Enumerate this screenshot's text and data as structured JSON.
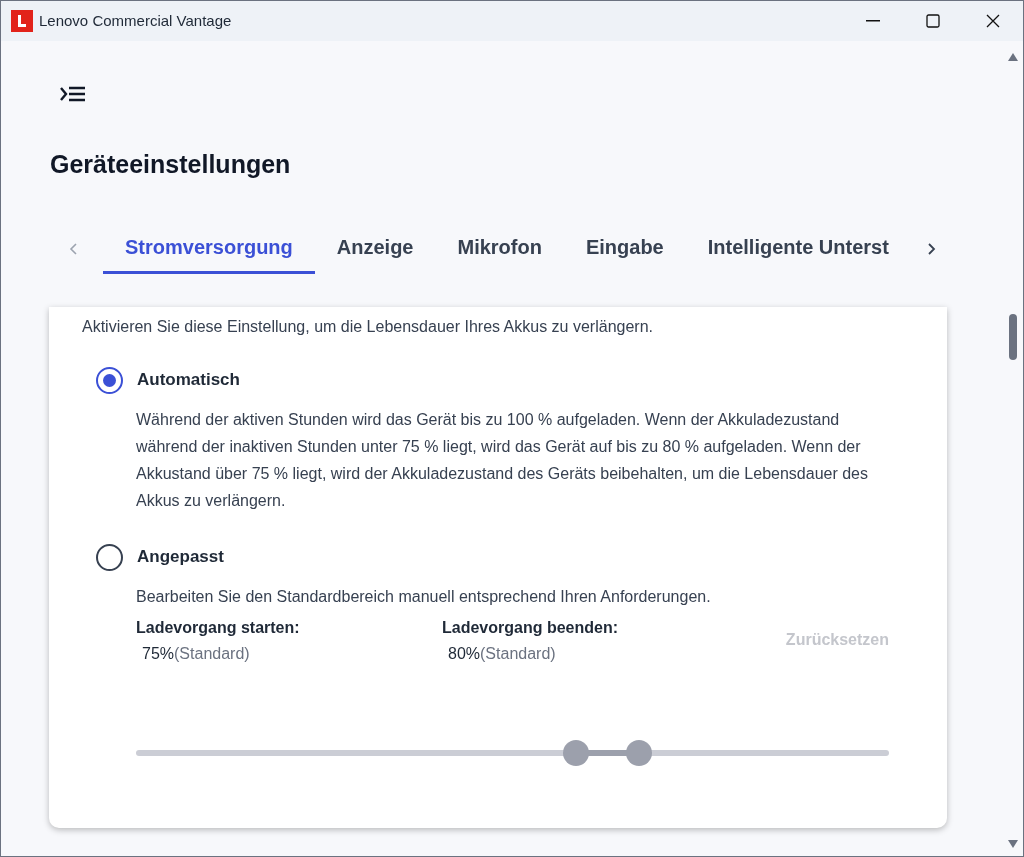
{
  "window": {
    "title": "Lenovo Commercial Vantage"
  },
  "page": {
    "title": "Geräteeinstellungen"
  },
  "tabs": [
    {
      "label": "Stromversorgung",
      "selected": true
    },
    {
      "label": "Anzeige",
      "selected": false
    },
    {
      "label": "Mikrofon",
      "selected": false
    },
    {
      "label": "Eingabe",
      "selected": false
    },
    {
      "label": "Intelligente Unterst",
      "selected": false
    }
  ],
  "card": {
    "intro": "Aktivieren Sie diese Einstellung, um die Lebensdauer Ihres Akkus zu verlängern.",
    "options": [
      {
        "label": "Automatisch",
        "selected": true,
        "description": "Während der aktiven Stunden wird das Gerät bis zu 100 % aufgeladen. Wenn der Akkuladezustand während der inaktiven Stunden unter 75 % liegt, wird das Gerät auf bis zu 80 % aufgeladen. Wenn der Akkustand über 75 % liegt, wird der Akkuladezustand des Geräts beibehalten, um die Lebensdauer des Akkus zu verlängern."
      },
      {
        "label": "Angepasst",
        "selected": false,
        "description": "Bearbeiten Sie den Standardbereich manuell entsprechend Ihren Anforderungen."
      }
    ],
    "range": {
      "disabled": true,
      "values": [
        {
          "label": "Ladevorgang starten:",
          "value": "75%",
          "note": "(Standard)"
        },
        {
          "label": "Ladevorgang beenden:",
          "value": "80%",
          "note": "(Standard)"
        }
      ],
      "reset": {
        "label": "Zurücksetzen",
        "disabled": true
      },
      "thumbs": [
        {
          "level": 0.584
        },
        {
          "level": 0.668
        }
      ]
    }
  }
}
